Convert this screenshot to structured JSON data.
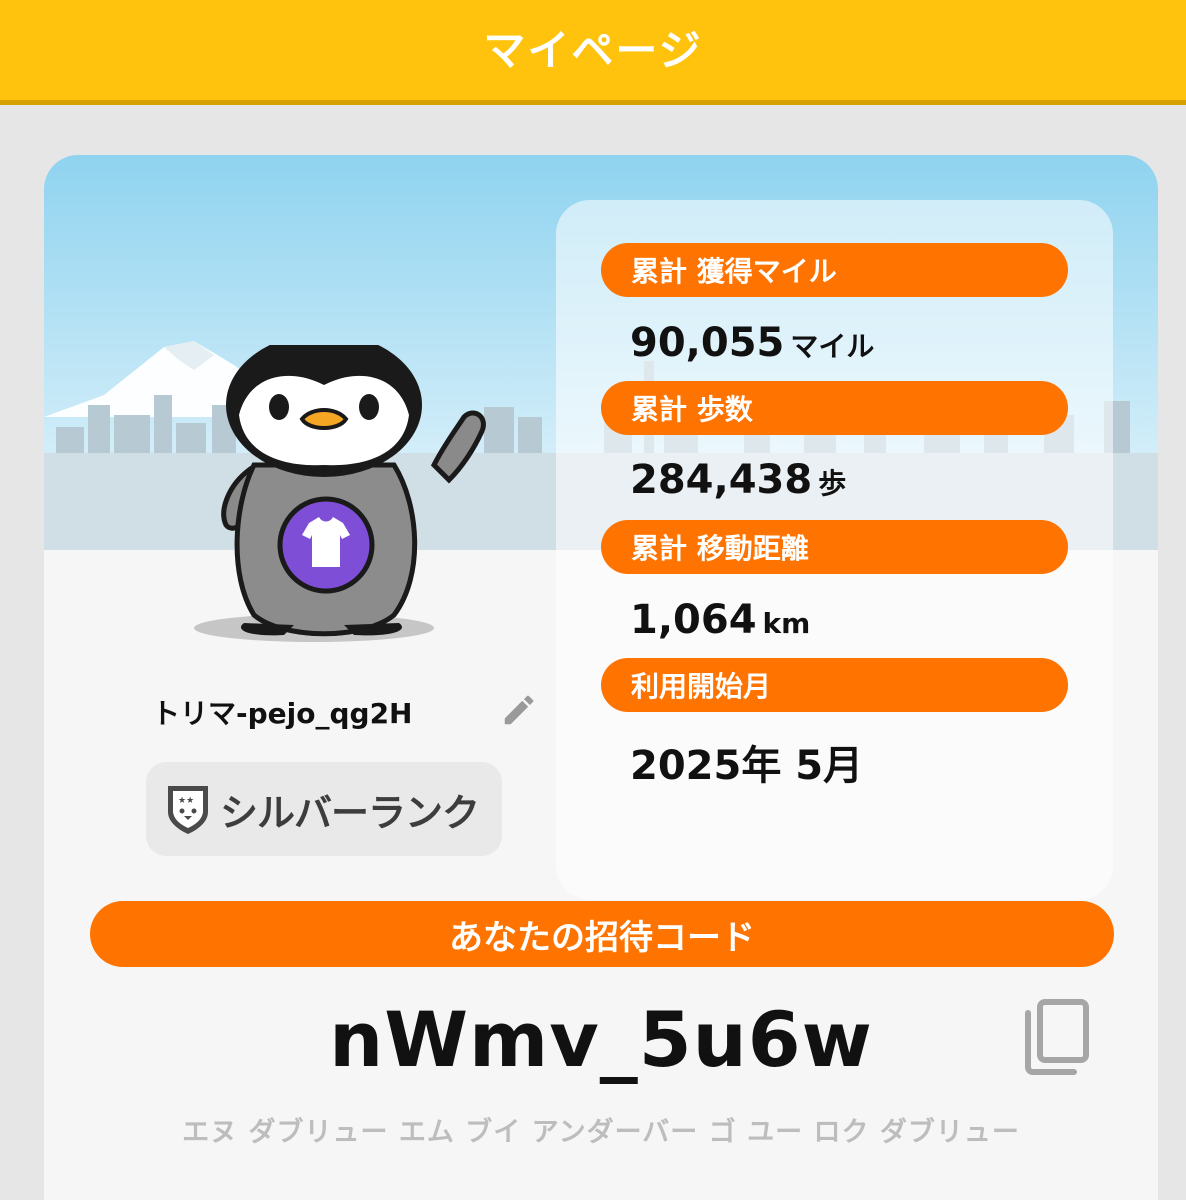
{
  "header": {
    "title": "マイページ"
  },
  "profile": {
    "username": "トリマ-pejo_qg2H",
    "rank_label": "シルバーランク"
  },
  "stats": [
    {
      "label": "累計 獲得マイル",
      "value": "90,055",
      "unit": "マイル"
    },
    {
      "label": "累計 歩数",
      "value": "284,438",
      "unit": "歩"
    },
    {
      "label": "累計 移動距離",
      "value": "1,064",
      "unit": "km"
    },
    {
      "label": "利用開始月",
      "value": "2025年 5月",
      "unit": ""
    }
  ],
  "invite": {
    "title": "あなたの招待コード",
    "code": "nWmv_5u6w",
    "reading": "エヌ ダブリュー エム ブイ アンダーバー ゴ ユー ロク ダブリュー"
  },
  "icons": {
    "edit": "pencil-icon",
    "copy": "copy-icon",
    "rank": "penguin-shield-icon",
    "shirt": "tshirt-icon"
  },
  "colors": {
    "header": "#ffc20d",
    "accent": "#ff7300",
    "sky": "#a9dcf2",
    "badge_purple": "#7e4fd6"
  }
}
